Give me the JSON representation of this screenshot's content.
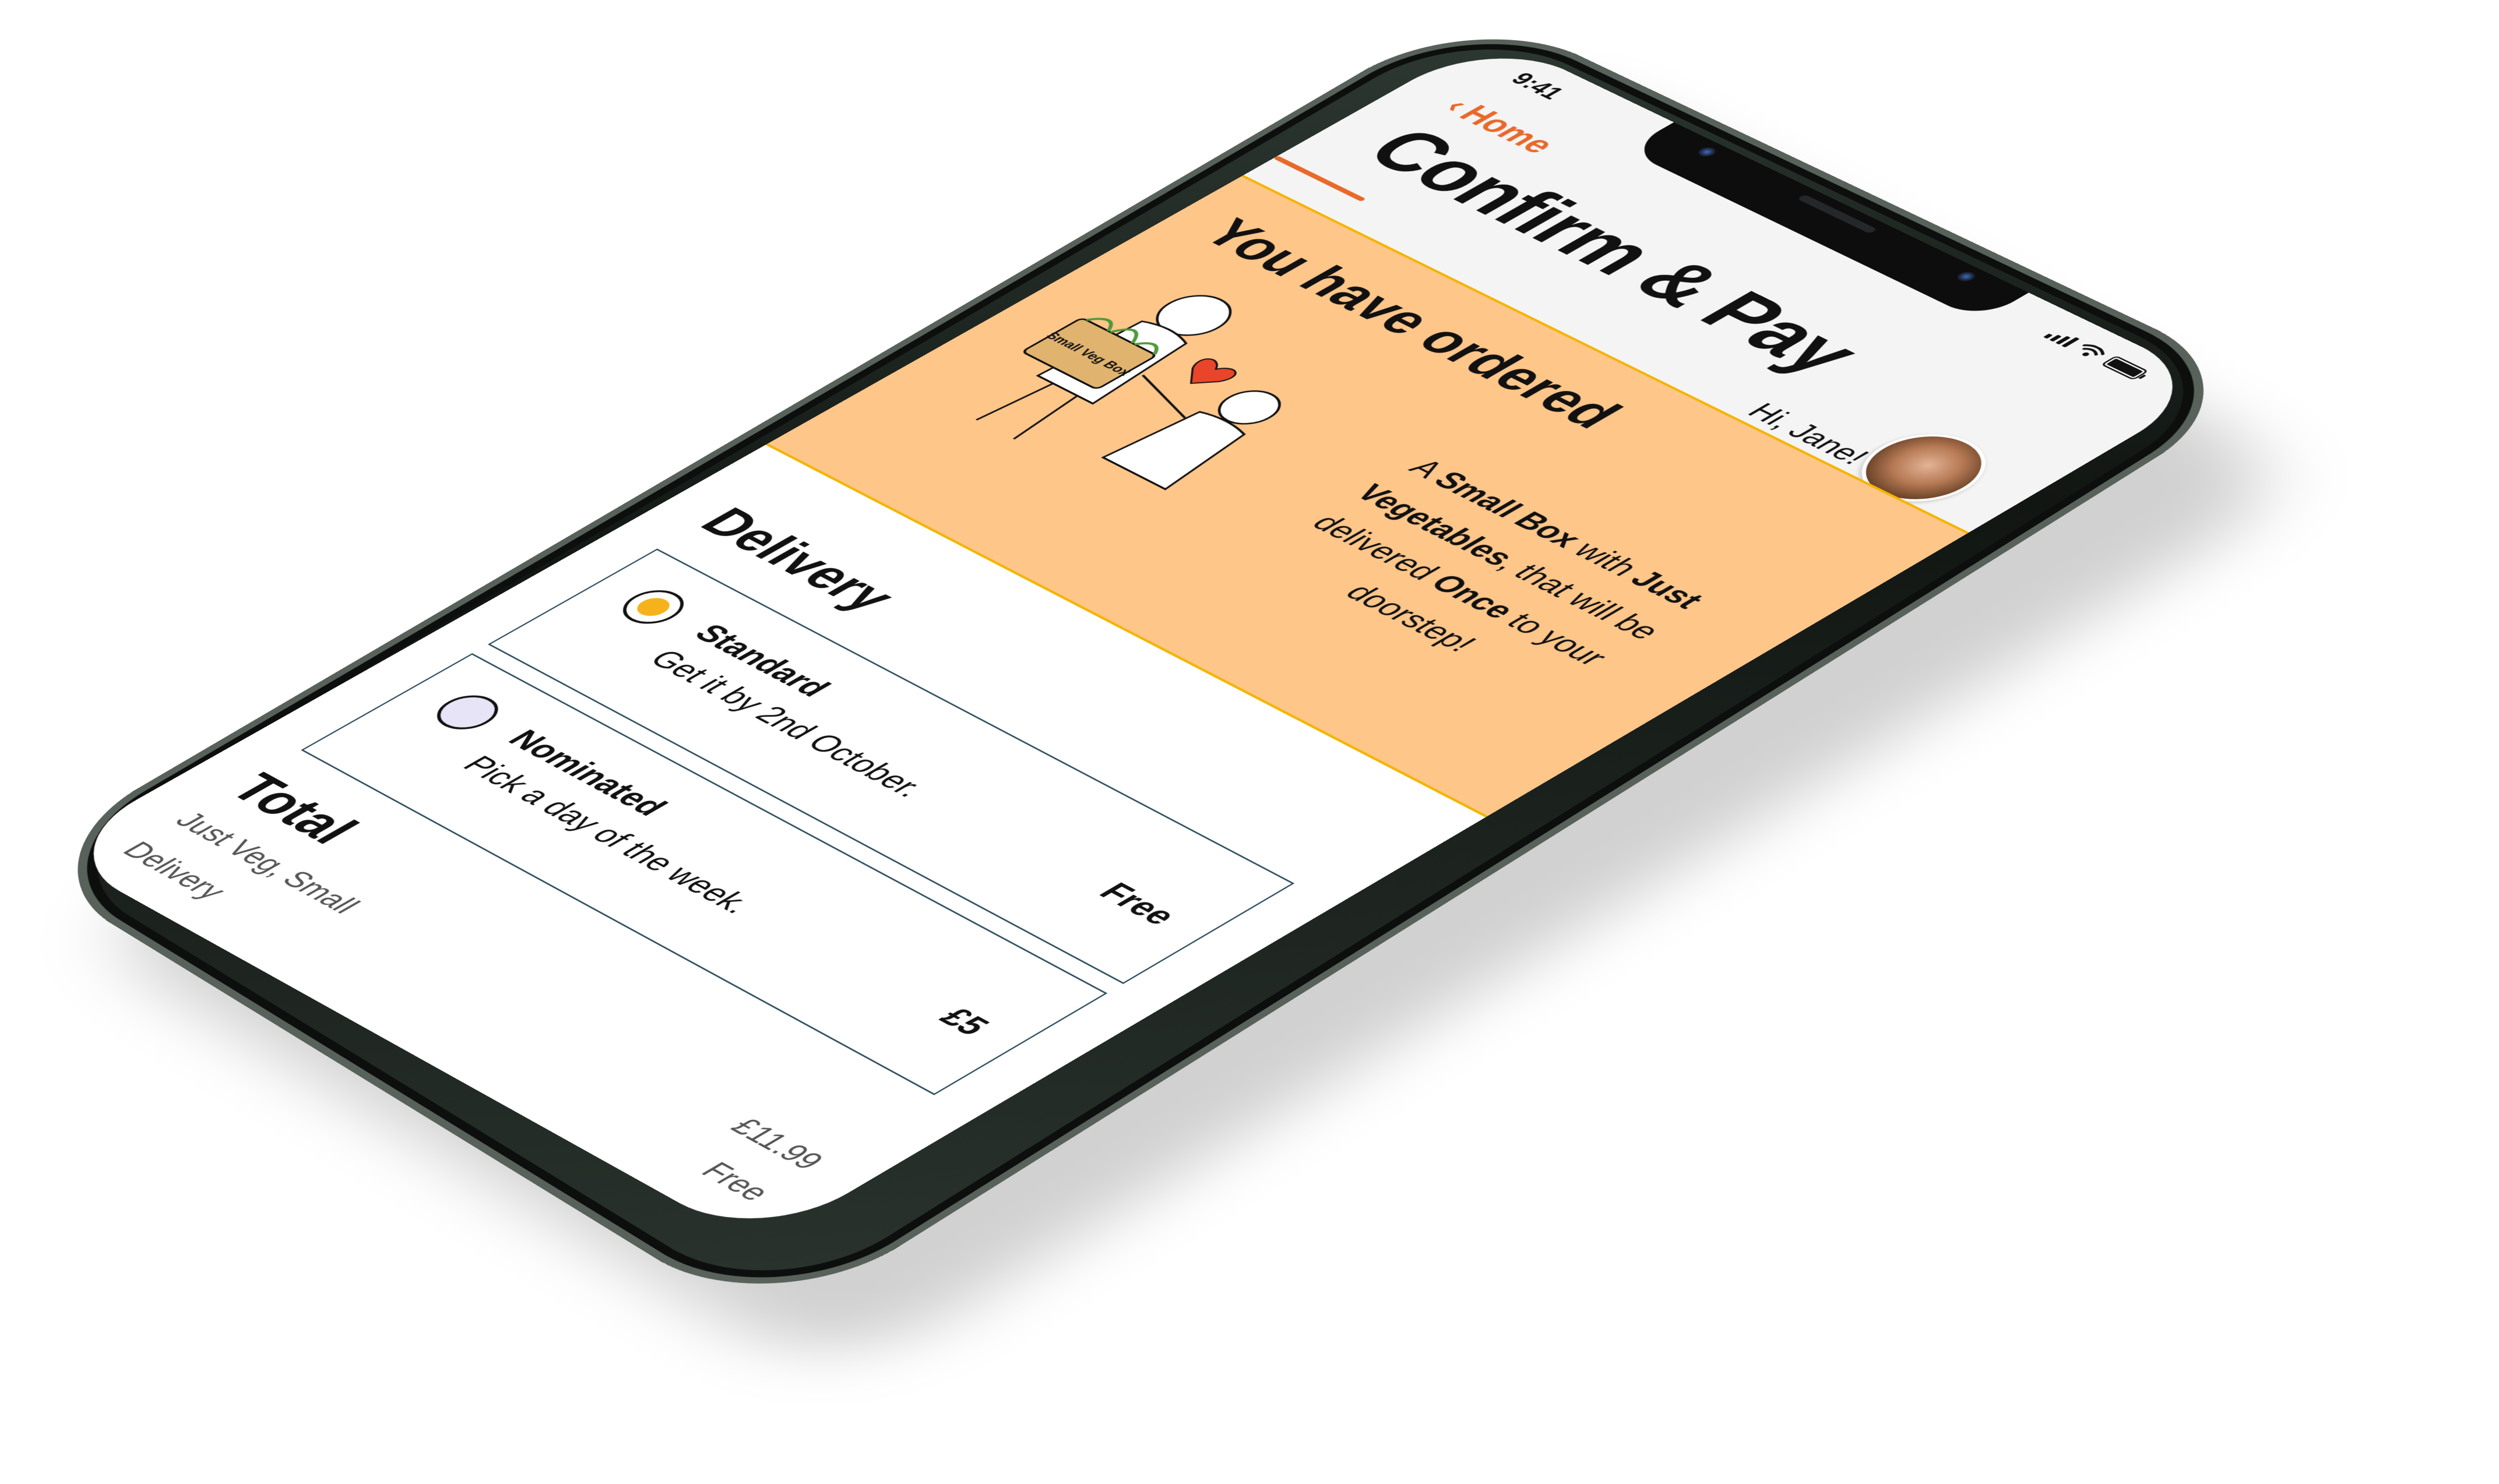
{
  "status_bar": {
    "time": "9:41"
  },
  "header": {
    "back_label": "Home",
    "title": "Confirm & Pay",
    "greeting": "Hi, Jane!"
  },
  "order": {
    "heading": "You have ordered",
    "illustration_bag_text": "Small Veg Box",
    "summary_prefix": "A ",
    "box_size": "Small Box",
    "summary_with": " with ",
    "box_contents": "Just Vegetables",
    "summary_mid": ", that will be delivered ",
    "frequency": "Once",
    "summary_suffix": " to your doorstep!"
  },
  "delivery": {
    "heading": "Delivery",
    "options": [
      {
        "name": "Standard",
        "description": "Get it by 2nd October.",
        "price": "Free",
        "selected": true
      },
      {
        "name": "Nominated",
        "description": "Pick a day of the week.",
        "price": "£5",
        "selected": false
      }
    ]
  },
  "total": {
    "heading": "Total",
    "lines": [
      {
        "label": "Just Veg, Small",
        "amount": "£11.99"
      },
      {
        "label": "Delivery",
        "amount": "Free"
      }
    ]
  },
  "colors": {
    "accent": "#e8692a",
    "order_panel": "#ffc68a",
    "order_border": "#f4b400",
    "radio_selected": "#f6b21b",
    "option_border": "#2f4f5f",
    "header_bg": "#f4f4f4"
  },
  "icons": {
    "back": "chevron-left-icon",
    "signal": "cellular-signal-icon",
    "wifi": "wifi-icon",
    "battery": "battery-icon"
  }
}
